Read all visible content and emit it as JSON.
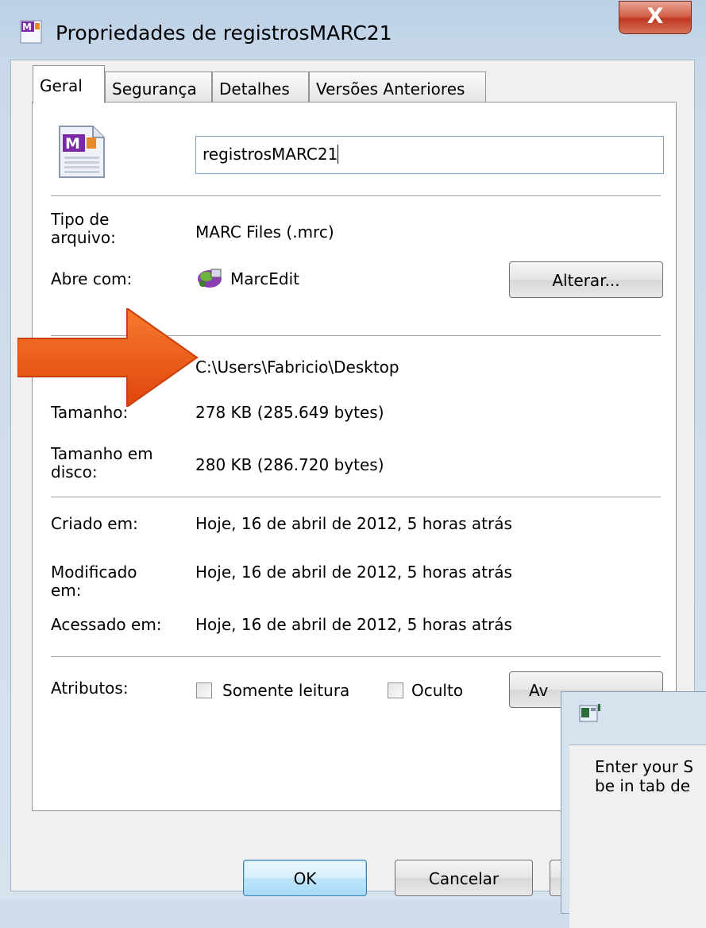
{
  "window": {
    "title": "Propriedades de registrosMARC21",
    "close_glyph": "X"
  },
  "tabs": [
    "Geral",
    "Segurança",
    "Detalhes",
    "Versões Anteriores"
  ],
  "general": {
    "file_name": "registrosMARC21",
    "file_type_label": "Tipo de arquivo:",
    "file_type_value": "MARC Files (.mrc)",
    "opens_with_label": "Abre com:",
    "opens_with_value": "MarcEdit",
    "change_button": "Alterar...",
    "location_value": "C:\\Users\\Fabricio\\Desktop",
    "size_label": "Tamanho:",
    "size_value": "278 KB (285.649 bytes)",
    "size_on_disk_label": "Tamanho em disco:",
    "size_on_disk_value": "280 KB (286.720 bytes)",
    "created_label": "Criado em:",
    "created_value": "Hoje, 16 de abril de 2012, 5 horas atrás",
    "modified_label": "Modificado em:",
    "modified_value": "Hoje, 16 de abril de 2012, 5 horas atrás",
    "accessed_label": "Acessado em:",
    "accessed_value": "Hoje, 16 de abril de 2012, 5 horas atrás",
    "attributes_label": "Atributos:",
    "readonly_label": "Somente leitura",
    "hidden_label": "Oculto",
    "advanced_button_visible": "Av"
  },
  "buttons": {
    "ok": "OK",
    "cancel": "Cancelar"
  },
  "popup": {
    "line1": "Enter your S",
    "line2": "be in tab de"
  },
  "icons": {
    "title": "marc-file-icon",
    "file": "marc-file-icon",
    "app": "marcedit-app-icon",
    "annotation": "orange-arrow-icon",
    "popup": "window-app-icon"
  },
  "colors": {
    "arrow": "#f05a16",
    "close_button": "#c9452b",
    "focus_border": "#3c7fb1"
  }
}
